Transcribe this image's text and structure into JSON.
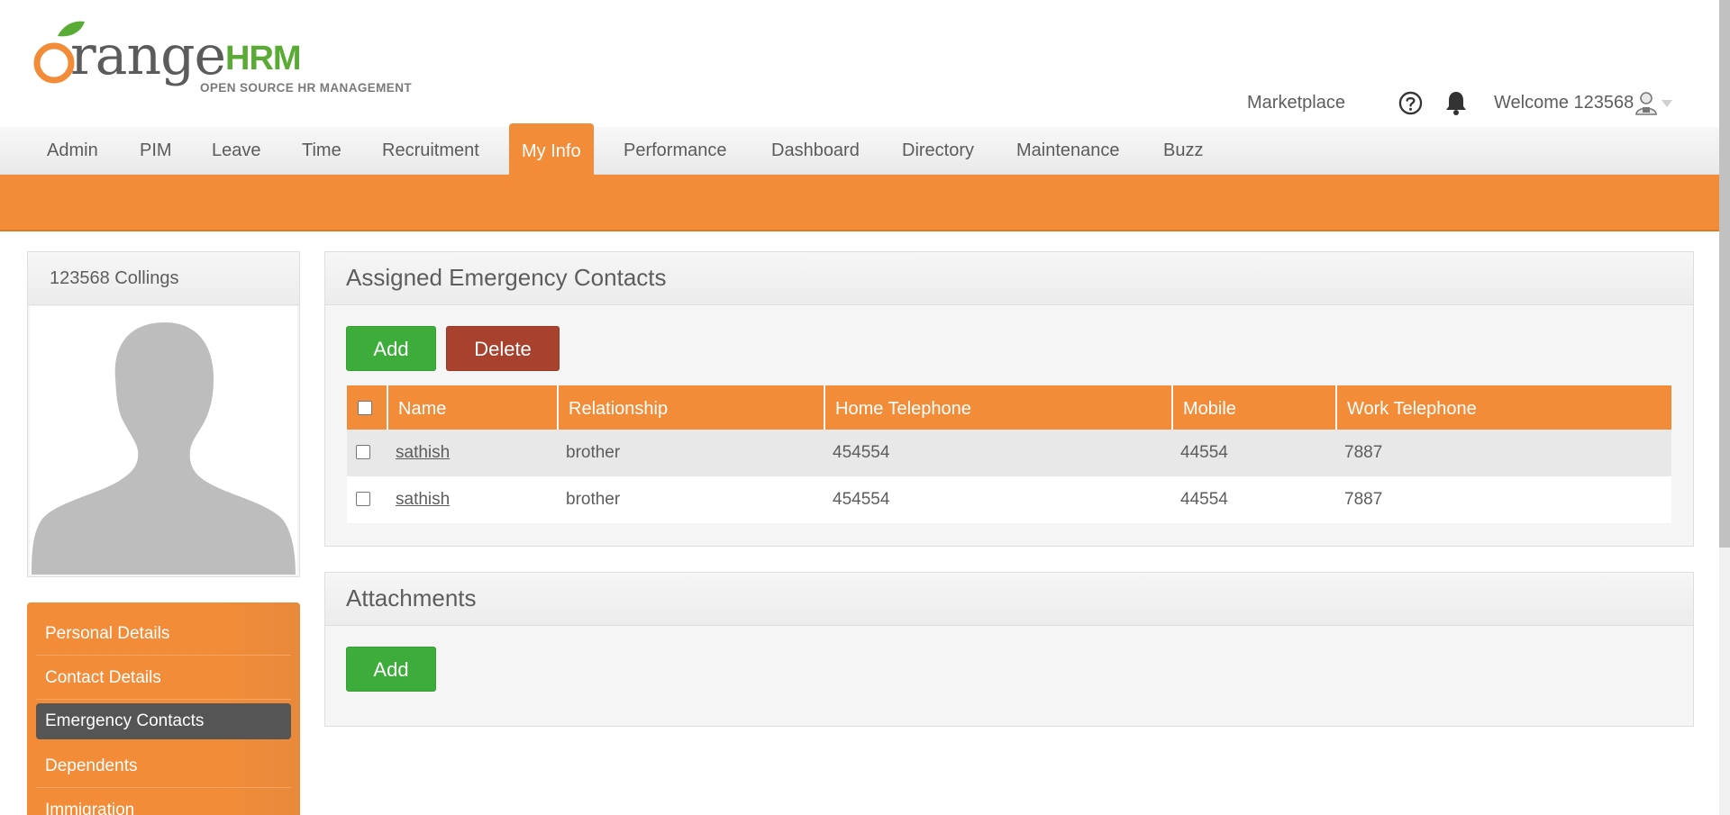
{
  "header": {
    "logo": {
      "wordmark": "range",
      "hrm": "HRM",
      "tagline": "OPEN SOURCE HR MANAGEMENT"
    },
    "marketplace_label": "Marketplace",
    "welcome_text": "Welcome 123568",
    "icons": {
      "help": "help-circle-icon",
      "notifications": "bell-icon",
      "user": "user-avatar-icon",
      "menu": "chevron-down-icon"
    }
  },
  "menu": {
    "items": [
      {
        "label": "Admin"
      },
      {
        "label": "PIM"
      },
      {
        "label": "Leave"
      },
      {
        "label": "Time"
      },
      {
        "label": "Recruitment"
      },
      {
        "label": "My Info"
      },
      {
        "label": "Performance"
      },
      {
        "label": "Dashboard"
      },
      {
        "label": "Directory"
      },
      {
        "label": "Maintenance"
      },
      {
        "label": "Buzz"
      }
    ],
    "active": "My Info"
  },
  "profile": {
    "name": "123568 Collings"
  },
  "sidebar": {
    "items": [
      {
        "label": "Personal Details"
      },
      {
        "label": "Contact Details"
      },
      {
        "label": "Emergency Contacts"
      },
      {
        "label": "Dependents"
      },
      {
        "label": "Immigration"
      }
    ],
    "active": "Emergency Contacts"
  },
  "emergency_contacts": {
    "title": "Assigned Emergency Contacts",
    "add_label": "Add",
    "delete_label": "Delete",
    "columns": [
      "Name",
      "Relationship",
      "Home Telephone",
      "Mobile",
      "Work Telephone"
    ],
    "rows": [
      {
        "name": "sathish",
        "relationship": "brother",
        "home_telephone": "454554",
        "mobile": "44554",
        "work_telephone": "7887"
      },
      {
        "name": "sathish",
        "relationship": "brother",
        "home_telephone": "454554",
        "mobile": "44554",
        "work_telephone": "7887"
      }
    ]
  },
  "attachments": {
    "title": "Attachments",
    "add_label": "Add"
  },
  "colors": {
    "brand_orange": "#f28c38",
    "add_green": "#3dac3b",
    "delete_red": "#a8412d",
    "active_sidebar": "#555555",
    "logo_green": "#5aab36"
  }
}
